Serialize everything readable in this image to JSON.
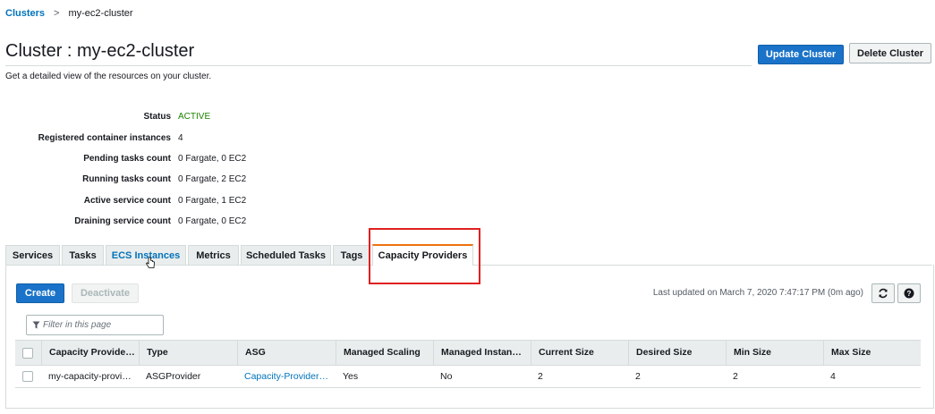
{
  "breadcrumb": {
    "root": "Clusters",
    "separator": ">",
    "current": "my-ec2-cluster"
  },
  "page": {
    "title": "Cluster : my-ec2-cluster",
    "subtitle": "Get a detailed view of the resources on your cluster."
  },
  "actions": {
    "update": "Update Cluster",
    "delete": "Delete Cluster"
  },
  "details": [
    {
      "label": "Status",
      "value": "ACTIVE"
    },
    {
      "label": "Registered container instances",
      "value": "4"
    },
    {
      "label": "Pending tasks count",
      "value": "0 Fargate, 0 EC2"
    },
    {
      "label": "Running tasks count",
      "value": "0 Fargate, 2 EC2"
    },
    {
      "label": "Active service count",
      "value": "0 Fargate, 1 EC2"
    },
    {
      "label": "Draining service count",
      "value": "0 Fargate, 0 EC2"
    }
  ],
  "tabs": [
    "Services",
    "Tasks",
    "ECS Instances",
    "Metrics",
    "Scheduled Tasks",
    "Tags",
    "Capacity Providers"
  ],
  "selected_tab": "Capacity Providers",
  "toolbar": {
    "create": "Create",
    "deactivate": "Deactivate",
    "last_updated": "Last updated on March 7, 2020 7:47:17 PM (0m ago)",
    "refresh_icon": "refresh-icon",
    "help_icon": "help-icon"
  },
  "filter": {
    "placeholder": "Filter in this page",
    "icon": "filter-icon"
  },
  "table": {
    "columns": [
      "Capacity Provide…",
      "Type",
      "ASG",
      "Managed Scaling",
      "Managed Instan…",
      "Current Size",
      "Desired Size",
      "Min Size",
      "Max Size"
    ],
    "rows": [
      [
        "my-capacity-provi…",
        "ASGProvider",
        "Capacity-Provider…",
        "Yes",
        "No",
        "2",
        "2",
        "2",
        "4"
      ]
    ]
  },
  "colors": {
    "primary": "#1a73c8",
    "link": "#0073bb",
    "active": "#1d8102",
    "highlight": "#e02020",
    "tab_accent": "#ec7211"
  }
}
